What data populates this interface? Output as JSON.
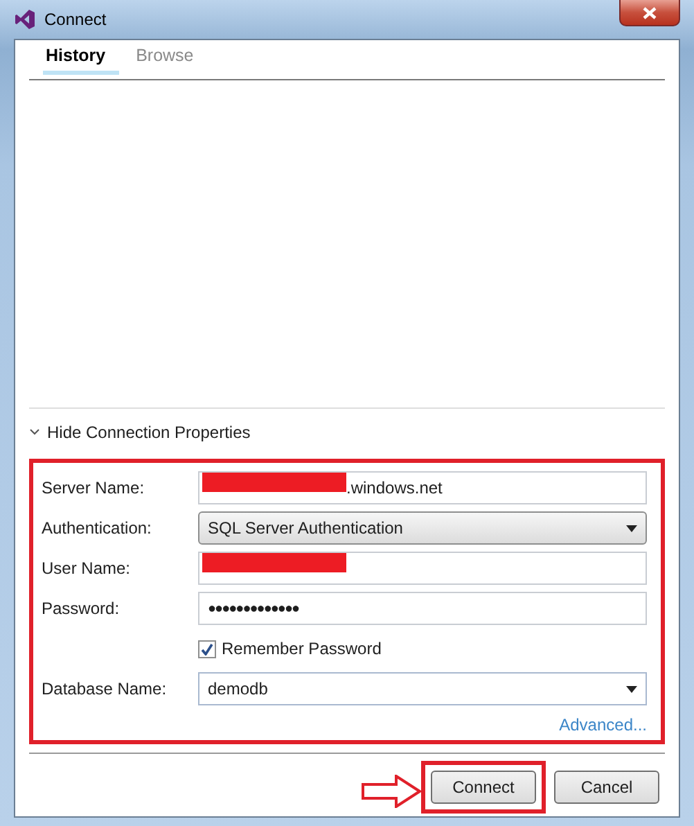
{
  "window": {
    "title": "Connect"
  },
  "tabs": [
    {
      "label": "History",
      "selected": true
    },
    {
      "label": "Browse",
      "selected": false
    }
  ],
  "properties_toggle": {
    "label": "Hide Connection Properties",
    "expanded": true
  },
  "form": [
    {
      "kind": "text",
      "label": "Server Name:",
      "value": ".windows.net",
      "redacted": true
    },
    {
      "kind": "dropdown",
      "label": "Authentication:",
      "value": "SQL Server Authentication"
    },
    {
      "kind": "text",
      "label": "User Name:",
      "redacted": true
    },
    {
      "kind": "text",
      "label": "Password:",
      "value": "●●●●●●●●●●●●●"
    },
    {
      "kind": "checkbox",
      "label": "Remember Password",
      "checked": true
    },
    {
      "kind": "combo",
      "label": "Database Name:",
      "value": "demodb"
    }
  ],
  "advanced_link": "Advanced...",
  "buttons": [
    {
      "label": "Connect",
      "highlighted": true
    },
    {
      "label": "Cancel",
      "highlighted": false
    }
  ]
}
